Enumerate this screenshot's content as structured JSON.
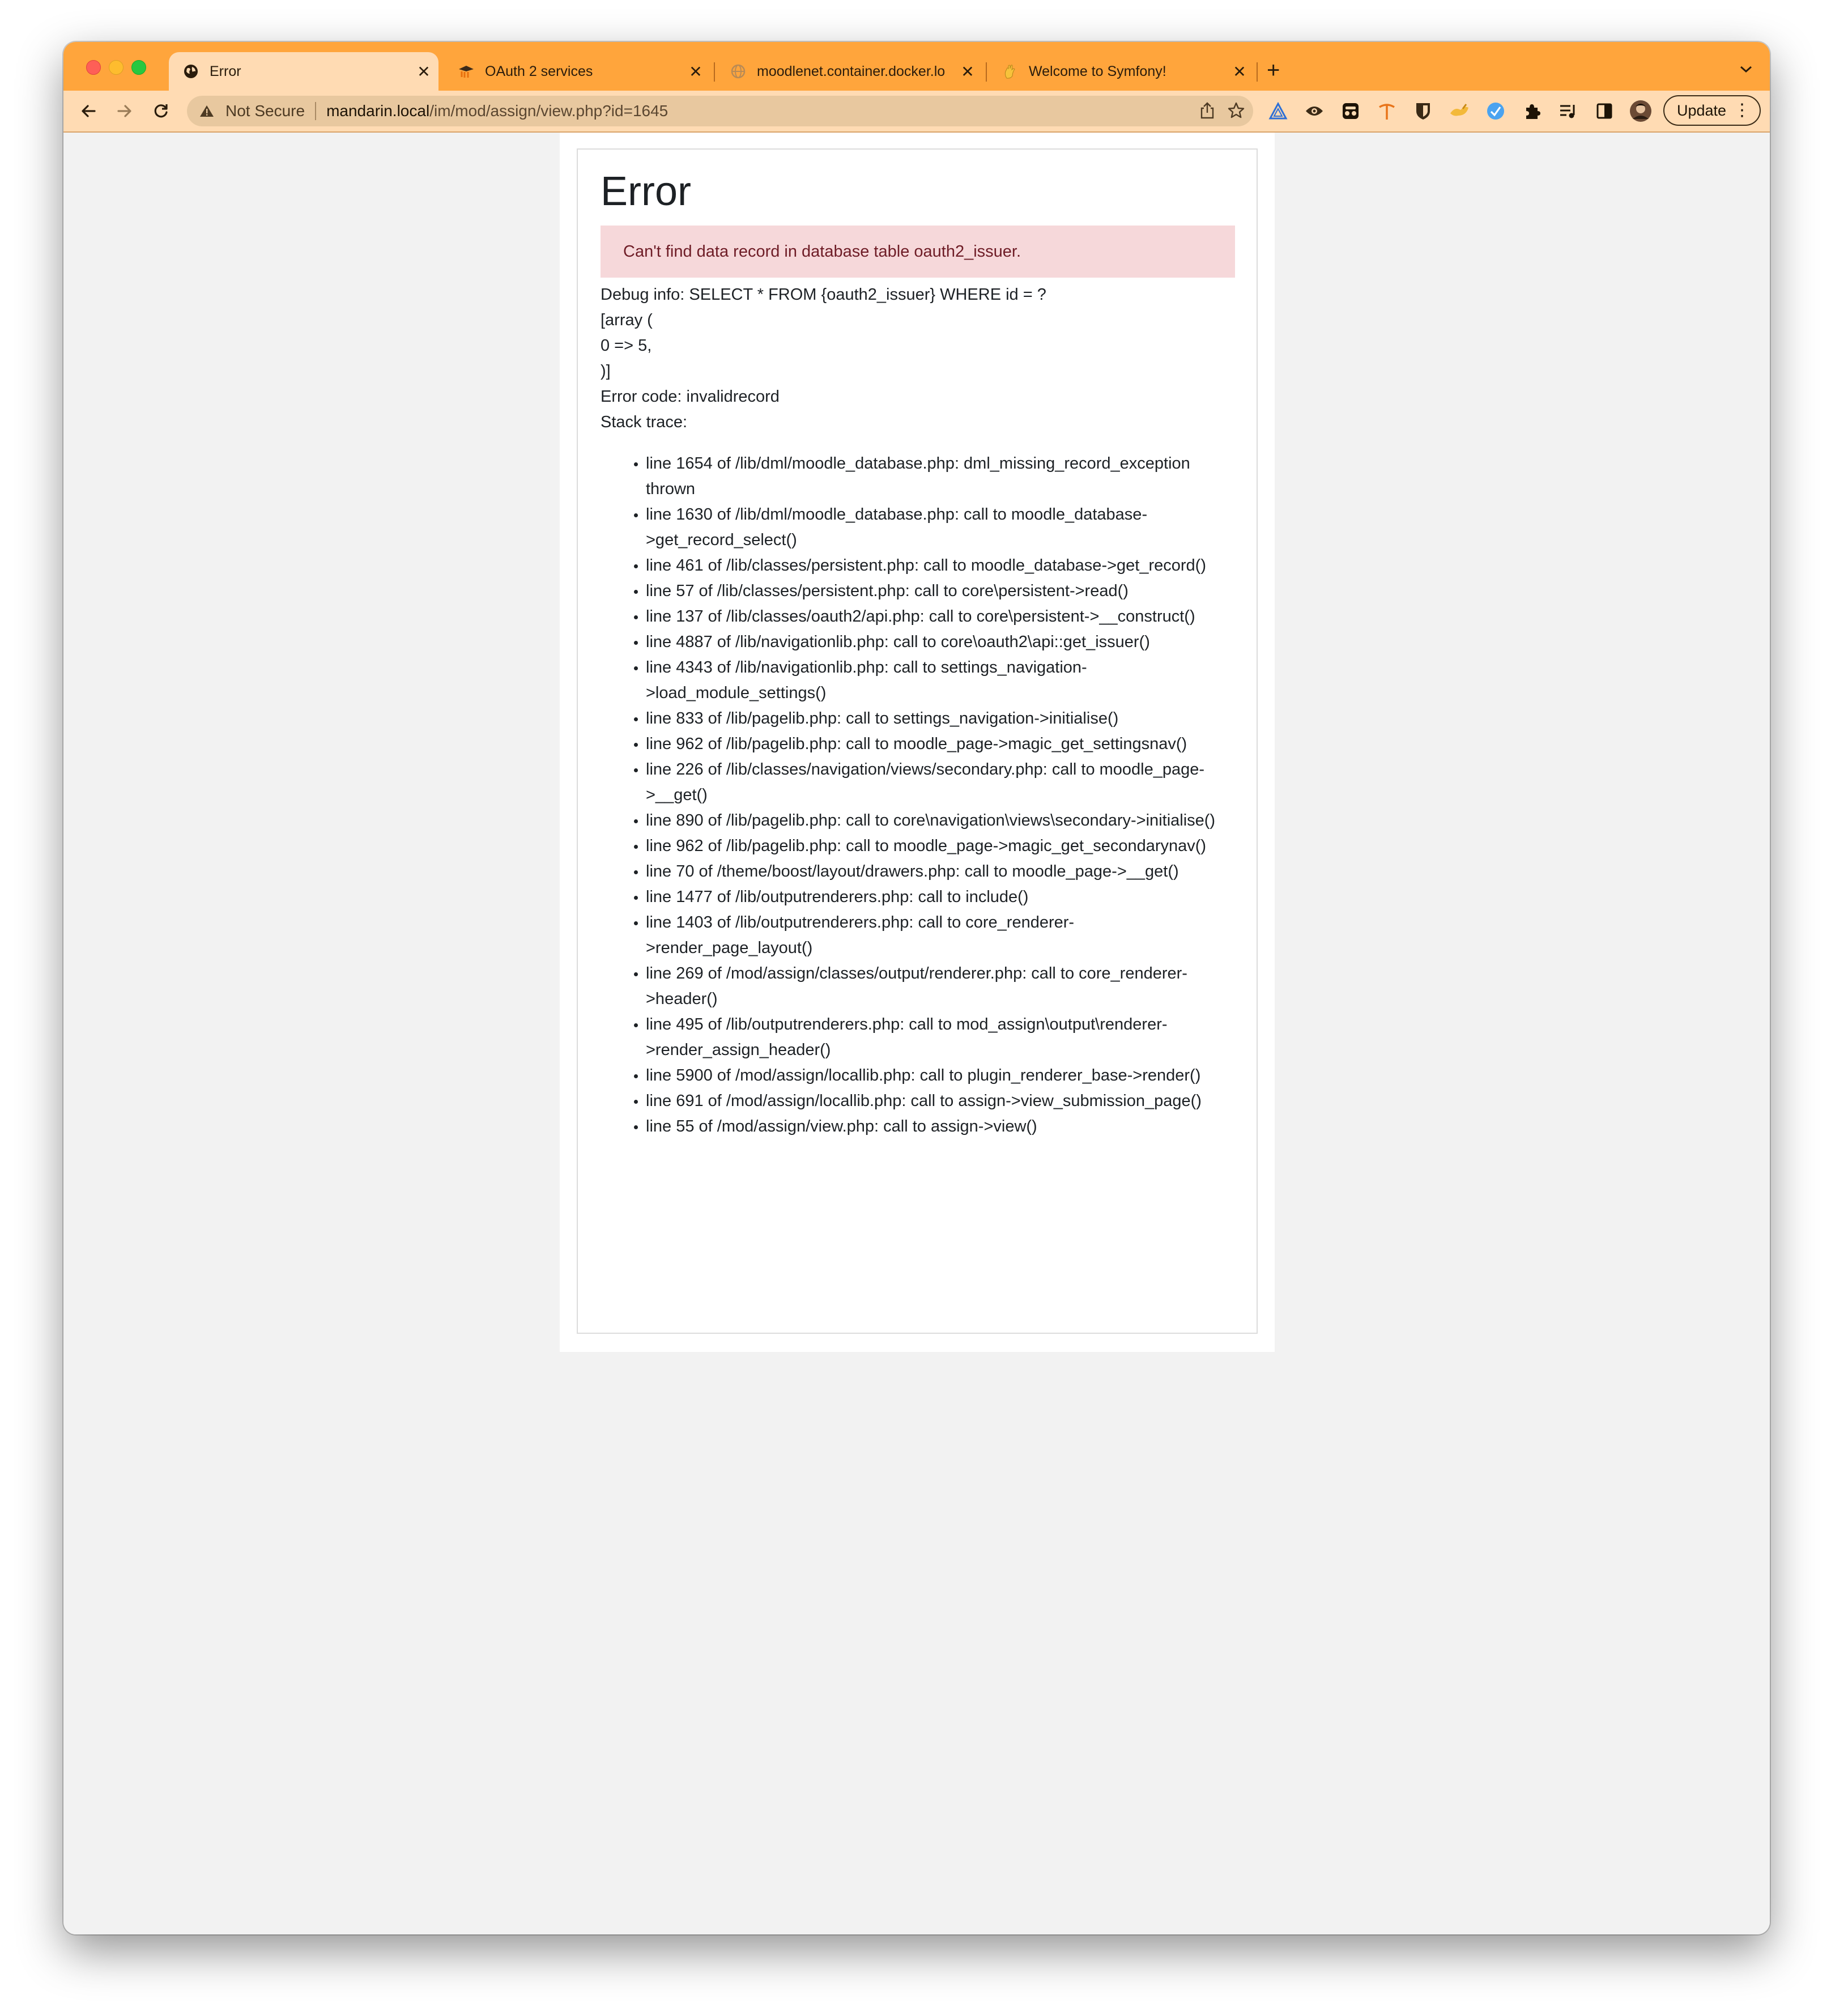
{
  "tabs": [
    {
      "title": "Error",
      "active": true,
      "favicon": "globe-icon"
    },
    {
      "title": "OAuth 2 services",
      "active": false,
      "favicon": "moodle-hat-icon"
    },
    {
      "title": "moodlenet.container.docker.lo",
      "active": false,
      "favicon": "globe-icon"
    },
    {
      "title": "Welcome to Symfony!",
      "active": false,
      "favicon": "hand-icon"
    }
  ],
  "omnibox": {
    "security_label": "Not Secure",
    "host": "mandarin.local",
    "path": "/im/mod/assign/view.php?id=1645"
  },
  "toolbar": {
    "update_label": "Update"
  },
  "page": {
    "title": "Error",
    "alert": "Can't find data record in database table oauth2_issuer.",
    "debug_lines": [
      "Debug info: SELECT * FROM {oauth2_issuer} WHERE id = ?",
      "[array (",
      "0 => 5,",
      ")]",
      "Error code: invalidrecord",
      "Stack trace:"
    ],
    "stack_trace": [
      "line 1654 of /lib/dml/moodle_database.php: dml_missing_record_exception thrown",
      "line 1630 of /lib/dml/moodle_database.php: call to moodle_database->get_record_select()",
      "line 461 of /lib/classes/persistent.php: call to moodle_database->get_record()",
      "line 57 of /lib/classes/persistent.php: call to core\\persistent->read()",
      "line 137 of /lib/classes/oauth2/api.php: call to core\\persistent->__construct()",
      "line 4887 of /lib/navigationlib.php: call to core\\oauth2\\api::get_issuer()",
      "line 4343 of /lib/navigationlib.php: call to settings_navigation->load_module_settings()",
      "line 833 of /lib/pagelib.php: call to settings_navigation->initialise()",
      "line 962 of /lib/pagelib.php: call to moodle_page->magic_get_settingsnav()",
      "line 226 of /lib/classes/navigation/views/secondary.php: call to moodle_page->__get()",
      "line 890 of /lib/pagelib.php: call to core\\navigation\\views\\secondary->initialise()",
      "line 962 of /lib/pagelib.php: call to moodle_page->magic_get_secondarynav()",
      "line 70 of /theme/boost/layout/drawers.php: call to moodle_page->__get()",
      "line 1477 of /lib/outputrenderers.php: call to include()",
      "line 1403 of /lib/outputrenderers.php: call to core_renderer->render_page_layout()",
      "line 269 of /mod/assign/classes/output/renderer.php: call to core_renderer->header()",
      "line 495 of /lib/outputrenderers.php: call to mod_assign\\output\\renderer->render_assign_header()",
      "line 5900 of /mod/assign/locallib.php: call to plugin_renderer_base->render()",
      "line 691 of /mod/assign/locallib.php: call to assign->view_submission_page()",
      "line 55 of /mod/assign/view.php: call to assign->view()"
    ]
  },
  "colors": {
    "tab_strip": "#ffa53c",
    "toolbar": "#ffdbb3",
    "alert_bg": "#f6d8da",
    "alert_text": "#6e1c26"
  }
}
